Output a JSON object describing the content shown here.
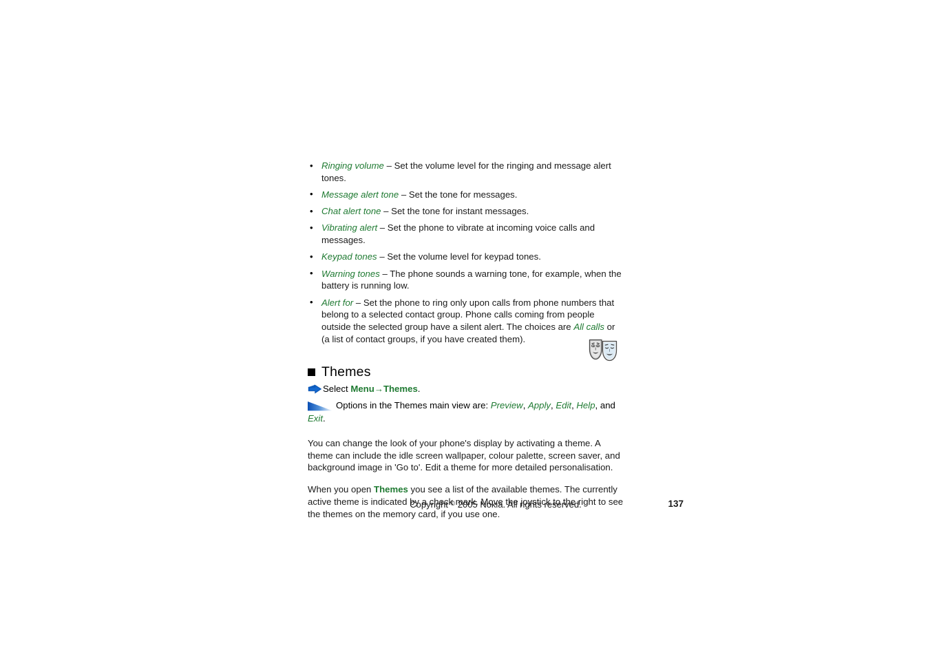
{
  "document": {
    "bullets": [
      {
        "term": "Ringing volume",
        "rest": " – Set the volume level for the ringing and message alert tones."
      },
      {
        "term": "Message alert tone",
        "rest": " – Set the tone for messages."
      },
      {
        "term": "Chat alert tone",
        "rest": " – Set the tone for instant messages."
      },
      {
        "term": "Vibrating alert",
        "rest": " – Set the phone to vibrate at incoming voice calls and messages."
      },
      {
        "term": "Keypad tones",
        "rest": " – Set the volume level for keypad tones."
      },
      {
        "term": "Warning tones",
        "rest": " – The phone sounds a warning tone, for example, when the battery is running low."
      }
    ],
    "alert_for": {
      "term": "Alert for",
      "part1": " – Set the phone to ring only upon calls from phone numbers that belong to a selected contact group. Phone calls coming from people outside the selected group have a silent alert. The choices are ",
      "highlight": "All calls",
      "part2": " or (a list of contact groups, if you have created them)."
    },
    "section": {
      "heading": "Themes",
      "select_prefix": "Select ",
      "select_path": "Menu→Themes",
      "select_suffix": ".",
      "options_prefix": "Options in the Themes main view are: ",
      "options": [
        "Preview",
        "Apply",
        "Edit",
        "Help"
      ],
      "options_separator": ", ",
      "options_and": "and ",
      "options_last": "Exit",
      "options_end": "."
    },
    "paragraphs": [
      {
        "text": "You can change the look of your phone's display by activating a theme. A theme can include the idle screen wallpaper, colour palette, screen saver, and background image in 'Go to'. Edit a theme for more detailed personalisation."
      }
    ],
    "paragraph_themes": {
      "prefix": "When you open ",
      "highlight": "Themes",
      "suffix": " you see a list of the available themes. The currently active theme is indicated by a check mark. Move the joystick to the right to see the themes on the memory card, if you use one."
    },
    "footer": {
      "copyright_pre": "Copyright ",
      "copyright_symbol": "©",
      "copyright_post": " 2005 Nokia. All rights reserved.",
      "page_number": "137"
    },
    "icons": {
      "arrow": "blue-right-arrow-icon",
      "options": "blue-gradient-triangle-icon",
      "masks": "theatre-masks-icon",
      "bullet_square": "black-square-bullet-icon"
    },
    "colors": {
      "green_term": "#1f7a32",
      "blue_icon": "#1060c0",
      "text": "#1a1a1a"
    }
  }
}
